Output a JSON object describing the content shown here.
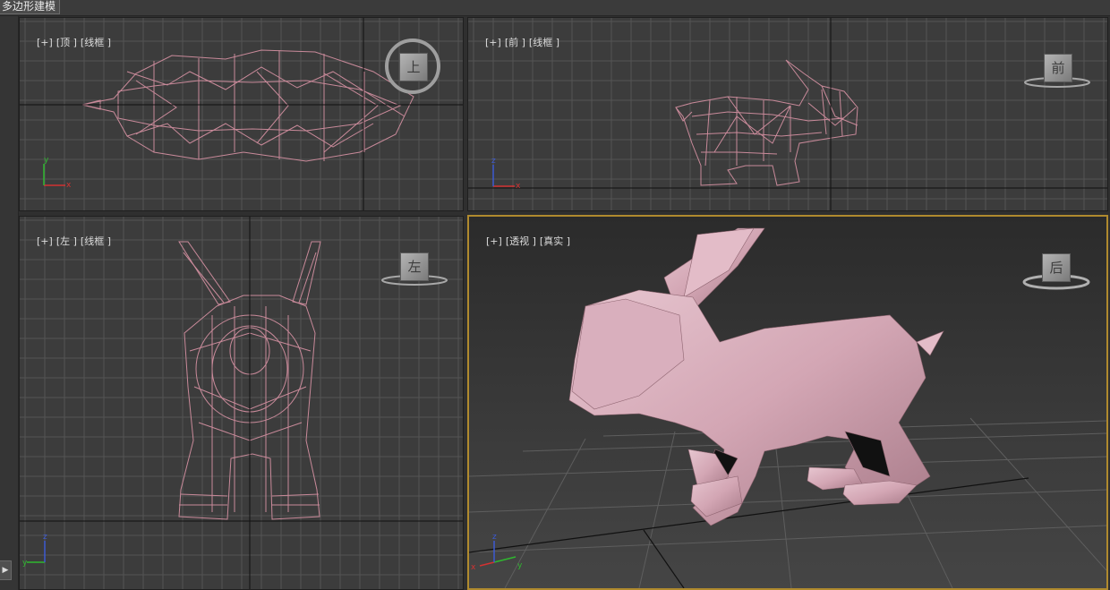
{
  "ribbon": {
    "tab_label": "多边形建模"
  },
  "viewports": {
    "top": {
      "plus": "[+]",
      "view": "[顶 ]",
      "mode": "[线框 ]",
      "cube_label": "上"
    },
    "front": {
      "plus": "[+]",
      "view": "[前 ]",
      "mode": "[线框 ]",
      "cube_label": "前"
    },
    "left": {
      "plus": "[+]",
      "view": "[左 ]",
      "mode": "[线框 ]",
      "cube_label": "左"
    },
    "persp": {
      "plus": "[+]",
      "view": "[透视 ]",
      "mode": "[真实 ]",
      "cube_label": "后"
    }
  },
  "axis_labels": {
    "x": "x",
    "y": "y",
    "z": "z"
  },
  "colors": {
    "grid_line": "#545454",
    "world_axis": "#111111",
    "wireframe": "#c98a9a",
    "mesh_fill": "#d8aab8",
    "active_border": "#b08a2e",
    "axis_x": "#d23232",
    "axis_y": "#2fb82f",
    "axis_z": "#3c5ad2"
  },
  "icons": {
    "expand": "play-triangle-icon"
  }
}
